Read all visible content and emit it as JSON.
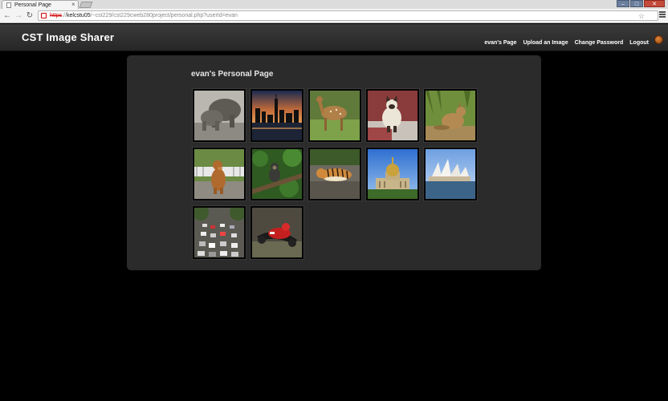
{
  "browser": {
    "tab_title": "Personal Page",
    "tab_close": "×",
    "window_controls": [
      "–",
      "□",
      "✕"
    ],
    "url_scheme": "https",
    "url_host": "kelcstu05",
    "url_path": "/~cst229/cst229cweb280project/personal.php?userId=evan",
    "nav_back": "←",
    "nav_forward": "→",
    "nav_reload": "↻",
    "star": "☆"
  },
  "site": {
    "brand": "CST Image Sharer",
    "nav": [
      {
        "label": "evan's Page"
      },
      {
        "label": "Upload an Image"
      },
      {
        "label": "Change Password"
      },
      {
        "label": "Logout"
      }
    ]
  },
  "main": {
    "title": "evan's Personal Page",
    "images": [
      {
        "subject": "elephants"
      },
      {
        "subject": "city skyline at dusk"
      },
      {
        "subject": "deer"
      },
      {
        "subject": "siamese cat"
      },
      {
        "subject": "kangaroo"
      },
      {
        "subject": "dog"
      },
      {
        "subject": "monkey in tree"
      },
      {
        "subject": "tiger"
      },
      {
        "subject": "domed palace"
      },
      {
        "subject": "sydney opera house"
      },
      {
        "subject": "traffic jam"
      },
      {
        "subject": "motorcycle racer"
      }
    ]
  },
  "colors": {
    "page_background": "#000000",
    "header_background": "#2f2f2f",
    "panel_background": "#2b2b2b",
    "text": "#ffffff"
  }
}
